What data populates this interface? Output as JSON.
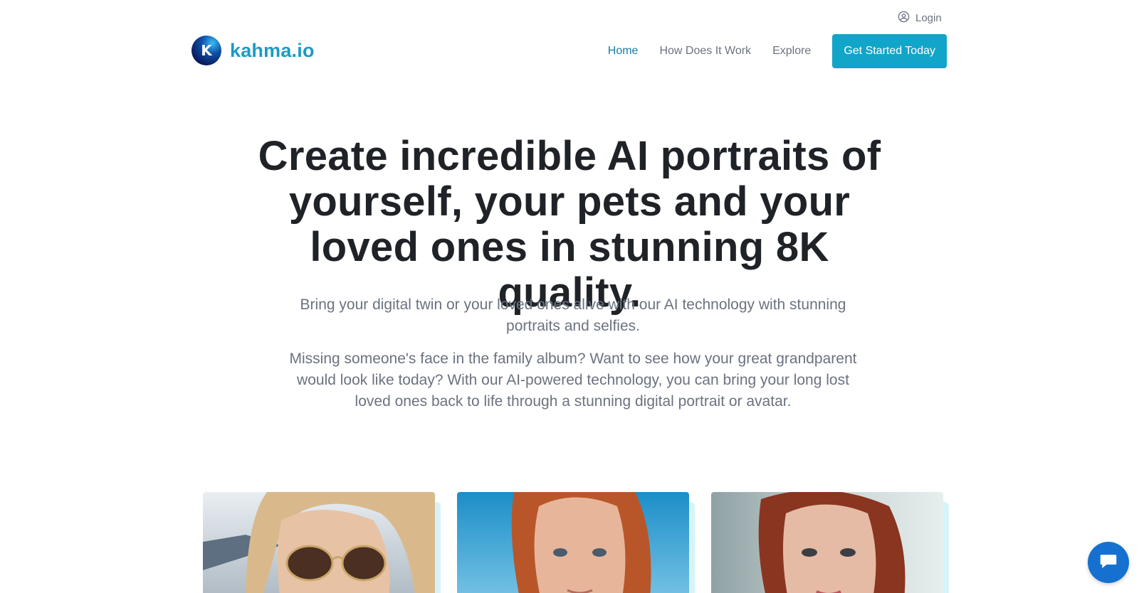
{
  "header": {
    "login_label": "Login",
    "logo_letter": "K",
    "logo_text": "kahma.io",
    "nav": [
      {
        "label": "Home",
        "active": true
      },
      {
        "label": "How Does It Work",
        "active": false
      },
      {
        "label": "Explore",
        "active": false
      }
    ],
    "cta_label": "Get Started Today"
  },
  "hero": {
    "title": "Create incredible AI portraits of yourself, your pets and your loved ones in stunning 8K quality.",
    "subtitle": "Bring your digital twin or your loved ones alive with our AI technology with stunning portraits and selfies.",
    "description": "Missing someone's face in the family album? Want to see how your great grandparent would look like today? With our AI-powered technology, you can bring your long lost loved ones back to life through a stunning digital portrait or avatar."
  },
  "gallery": {
    "items": [
      {
        "name": "portrait-blonde-sunglasses"
      },
      {
        "name": "portrait-redhead-blue-sky"
      },
      {
        "name": "portrait-redhead-indoor"
      }
    ]
  },
  "colors": {
    "brand": "#1a9cc4",
    "cta": "#11a5c9",
    "nav_active": "#1a7ea6",
    "text_muted": "#6b7280",
    "chat": "#1570d0"
  },
  "icons": {
    "login": "user-circle-icon",
    "chat": "chat-bubble-icon"
  }
}
